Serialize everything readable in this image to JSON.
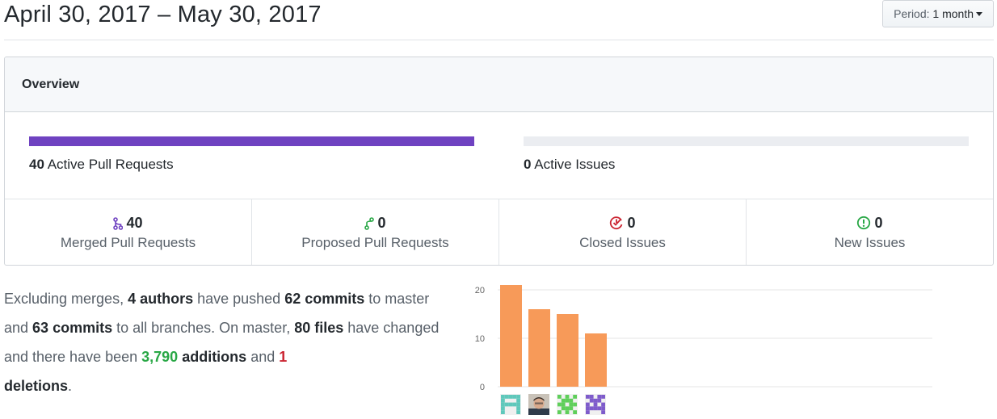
{
  "header": {
    "title": "April 30, 2017 – May 30, 2017",
    "period_label": "Period:",
    "period_value": "1 month"
  },
  "overview": {
    "title": "Overview",
    "pull_requests": {
      "count": "40",
      "label": "Active Pull Requests",
      "fill_fraction": 1.0,
      "color": "#6f42c1"
    },
    "issues": {
      "count": "0",
      "label": "Active Issues",
      "fill_fraction": 0.0,
      "color": "#ebedf1"
    },
    "stats": [
      {
        "icon": "git-merge-icon",
        "value": "40",
        "label": "Merged Pull Requests",
        "color": "#6f42c1"
      },
      {
        "icon": "git-pull-request-icon",
        "value": "0",
        "label": "Proposed Pull Requests",
        "color": "#28a745"
      },
      {
        "icon": "issue-closed-icon",
        "value": "0",
        "label": "Closed Issues",
        "color": "#cb2431"
      },
      {
        "icon": "issue-opened-icon",
        "value": "0",
        "label": "New Issues",
        "color": "#28a745"
      }
    ]
  },
  "summary": {
    "t1": "Excluding merges, ",
    "authors": "4 authors",
    "t2": " have pushed ",
    "commits_master": "62 commits",
    "t3": " to master and ",
    "commits_all": "63 commits",
    "t4": " to all branches. On master, ",
    "files": "80 files",
    "t5": " have changed and there have been ",
    "additions_num": "3,790",
    "additions_word": " additions",
    "t6": " and ",
    "deletions_num": "1",
    "deletions_word": "deletions",
    "t7": "."
  },
  "chart_data": {
    "type": "bar",
    "categories": [
      "author-1",
      "author-2",
      "author-3",
      "author-4"
    ],
    "values": [
      21,
      16,
      15,
      11
    ],
    "ylim": [
      0,
      20
    ],
    "yticks": [
      0,
      10,
      20
    ],
    "color": "#f79a59",
    "grid": true
  },
  "avatars": [
    {
      "name": "author-avatar-1",
      "type": "identicon",
      "color": "#5fc8bb"
    },
    {
      "name": "author-avatar-2",
      "type": "photo"
    },
    {
      "name": "author-avatar-3",
      "type": "identicon",
      "color": "#5fcf5a"
    },
    {
      "name": "author-avatar-4",
      "type": "identicon",
      "color": "#7e5bcb"
    }
  ]
}
